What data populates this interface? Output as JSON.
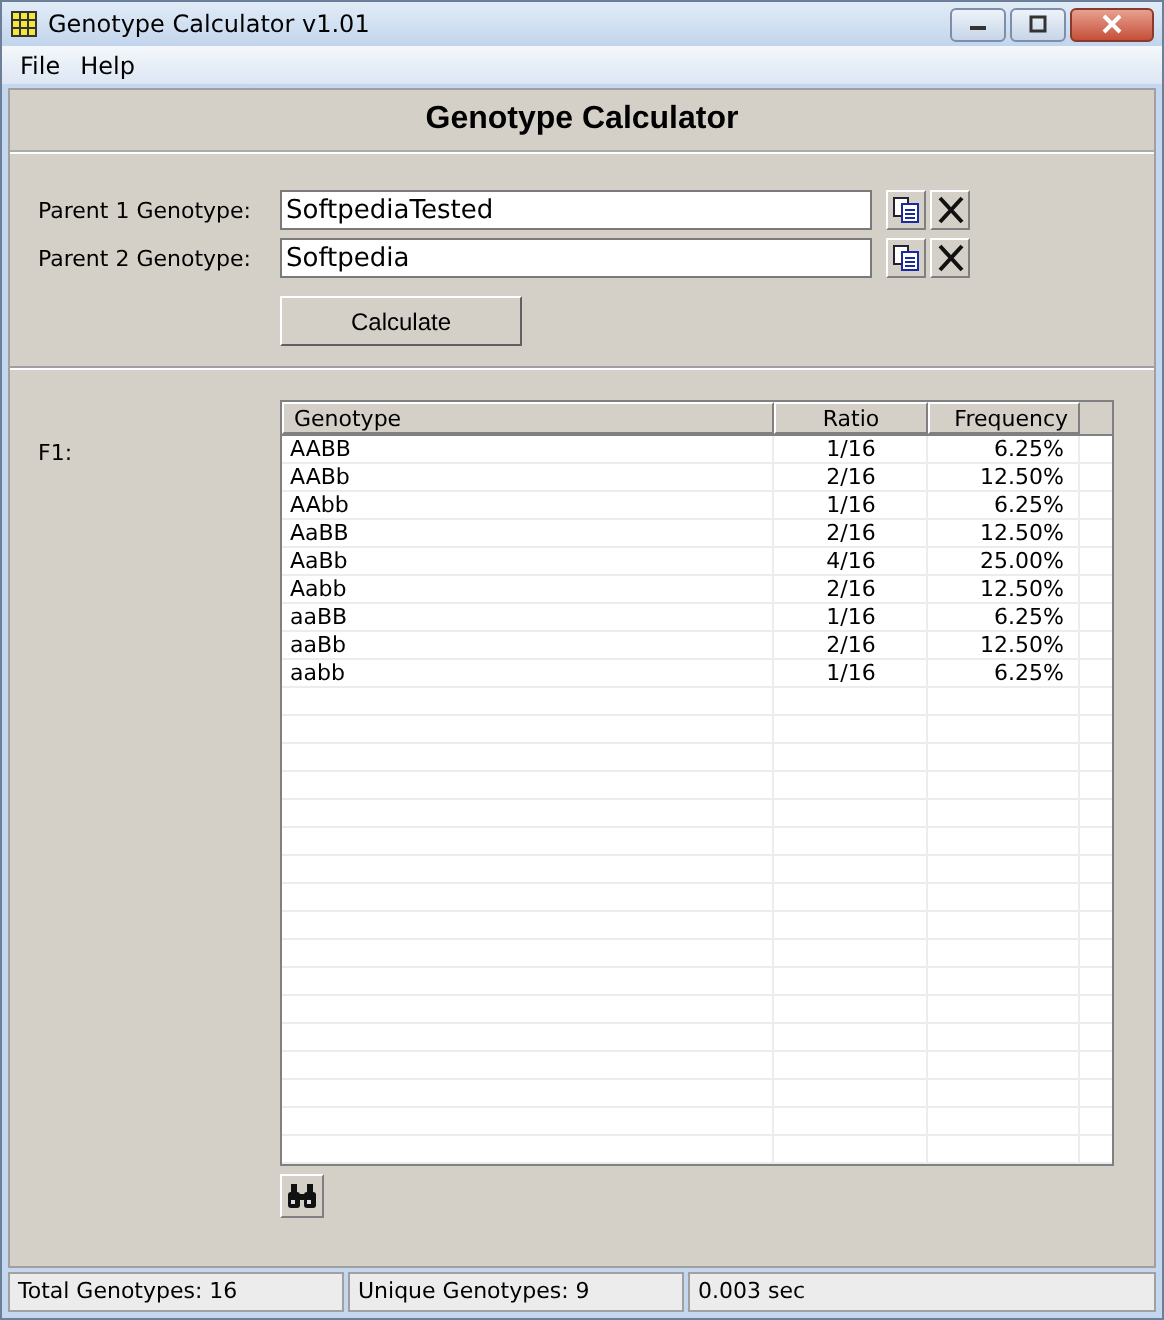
{
  "window": {
    "title": "Genotype Calculator v1.01"
  },
  "menu": [
    "File",
    "Help"
  ],
  "heading": "Genotype Calculator",
  "parents": [
    {
      "label": "Parent 1 Genotype:",
      "value": "SoftpediaTested"
    },
    {
      "label": "Parent 2 Genotype:",
      "value": "Softpedia"
    }
  ],
  "calculate_button": "Calculate",
  "result_label": "F1:",
  "table": {
    "columns": [
      "Genotype",
      "Ratio",
      "Frequency"
    ],
    "rows": [
      [
        "AABB",
        "1/16",
        "6.25%"
      ],
      [
        "AABb",
        "2/16",
        "12.50%"
      ],
      [
        "AAbb",
        "1/16",
        "6.25%"
      ],
      [
        "AaBB",
        "2/16",
        "12.50%"
      ],
      [
        "AaBb",
        "4/16",
        "25.00%"
      ],
      [
        "Aabb",
        "2/16",
        "12.50%"
      ],
      [
        "aaBB",
        "1/16",
        "6.25%"
      ],
      [
        "aaBb",
        "2/16",
        "12.50%"
      ],
      [
        "aabb",
        "1/16",
        "6.25%"
      ]
    ]
  },
  "status_bar": [
    "Total Genotypes: 16",
    "Unique Genotypes: 9",
    "0.003 sec"
  ]
}
